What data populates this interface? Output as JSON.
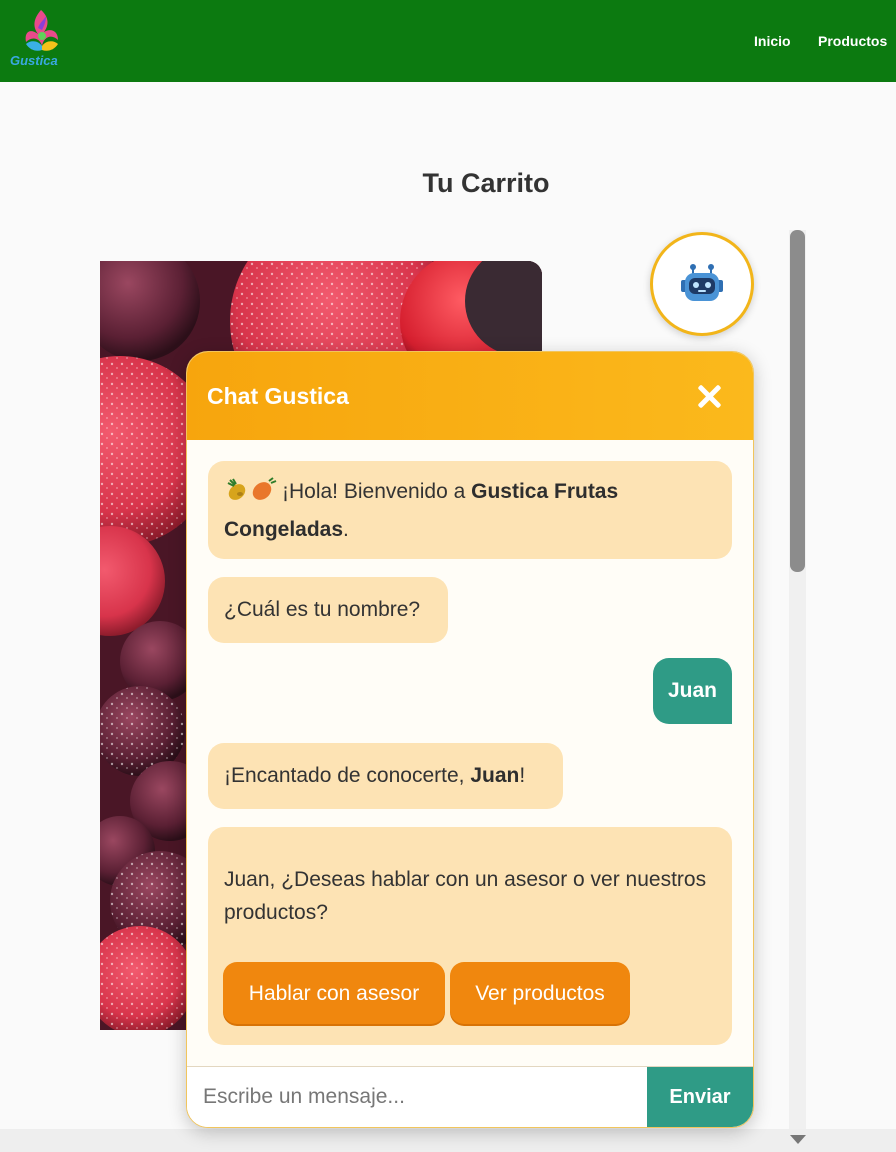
{
  "nav": {
    "logo_text": "Gustica",
    "links": [
      "Inicio",
      "Productos"
    ]
  },
  "page": {
    "title": "Tu Carrito"
  },
  "chat": {
    "title": "Chat Gustica",
    "messages": {
      "welcome_prefix": "¡Hola! Bienvenido a ",
      "welcome_brand": "Gustica Frutas Congeladas",
      "welcome_suffix": ".",
      "ask_name": "¿Cuál es tu nombre?",
      "user_reply": "Juan",
      "greet_prefix": "¡Encantado de conocerte, ",
      "greet_name": "Juan",
      "greet_suffix": "!",
      "question": "Juan, ¿Deseas hablar con un asesor o ver nuestros productos?"
    },
    "options": [
      "Hablar con asesor",
      "Ver productos"
    ],
    "input_placeholder": "Escribe un mensaje...",
    "send_label": "Enviar"
  },
  "colors": {
    "nav_bg": "#0c7a10",
    "chat_header": "#f7a50d",
    "bot_bubble": "#fde3b4",
    "user_bubble": "#2f9b86",
    "option_button": "#f0870e"
  },
  "icons": {
    "bot": "robot-icon",
    "close": "close-icon",
    "fruits": "pineapple-carrot-emoji"
  }
}
